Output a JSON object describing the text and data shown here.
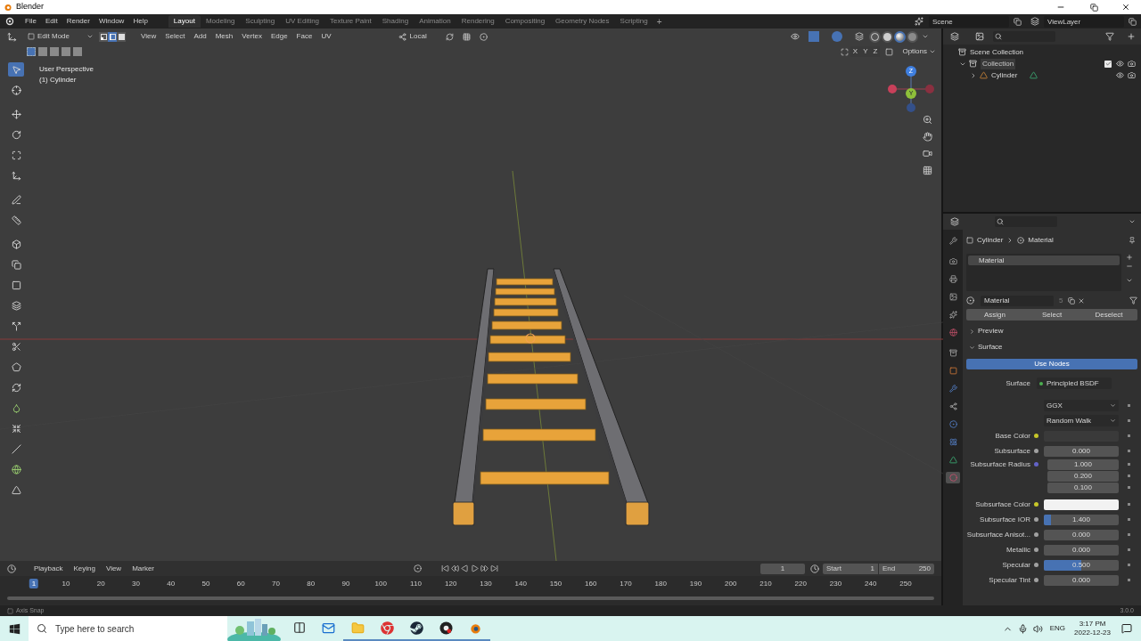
{
  "window": {
    "title": "Blender"
  },
  "menus": [
    "File",
    "Edit",
    "Render",
    "Window",
    "Help"
  ],
  "workspaces": [
    {
      "label": "Layout",
      "selected": true
    },
    {
      "label": "Modeling",
      "selected": false
    },
    {
      "label": "Sculpting",
      "selected": false
    },
    {
      "label": "UV Editing",
      "selected": false
    },
    {
      "label": "Texture Paint",
      "selected": false
    },
    {
      "label": "Shading",
      "selected": false
    },
    {
      "label": "Animation",
      "selected": false
    },
    {
      "label": "Rendering",
      "selected": false
    },
    {
      "label": "Compositing",
      "selected": false
    },
    {
      "label": "Geometry Nodes",
      "selected": false
    },
    {
      "label": "Scripting",
      "selected": false
    }
  ],
  "add_workspace": "+",
  "scene": "Scene",
  "view_layer": "ViewLayer",
  "viewport": {
    "mode": "Edit Mode",
    "select_modes": [
      {
        "kind": "vertex",
        "selected": false
      },
      {
        "kind": "edge",
        "selected": true
      },
      {
        "kind": "face",
        "selected": false
      }
    ],
    "menus": [
      "View",
      "Select",
      "Add",
      "Mesh",
      "Vertex",
      "Edge",
      "Face",
      "UV"
    ],
    "orientation": "Local",
    "shading": [
      {
        "kind": "wire",
        "selected": false
      },
      {
        "kind": "solid",
        "selected": false
      },
      {
        "kind": "material",
        "selected": true
      },
      {
        "kind": "rendered",
        "selected": false
      }
    ],
    "mirror_axes": [
      "X",
      "Y",
      "Z"
    ],
    "options": "Options",
    "overlay_text": [
      "User Perspective",
      "(1) Cylinder"
    ],
    "gizmo_labels": [
      "Z",
      "Y"
    ],
    "tools": [
      {
        "kind": "select",
        "selected": true
      },
      {
        "kind": "cursor",
        "selected": false
      },
      {
        "kind": "move",
        "selected": false
      },
      {
        "kind": "rotate",
        "selected": false
      },
      {
        "kind": "scale",
        "selected": false
      },
      {
        "kind": "transform",
        "selected": false
      },
      {
        "kind": "annotate",
        "selected": false
      },
      {
        "kind": "measure",
        "selected": false
      },
      {
        "kind": "add-cube",
        "selected": false
      },
      {
        "kind": "extrude",
        "selected": false
      },
      {
        "kind": "inset",
        "selected": false
      },
      {
        "kind": "bevel",
        "selected": false
      },
      {
        "kind": "loop-cut",
        "selected": false
      },
      {
        "kind": "knife",
        "selected": false
      },
      {
        "kind": "poly-build",
        "selected": false
      },
      {
        "kind": "spin",
        "selected": false
      },
      {
        "kind": "smooth",
        "selected": false
      },
      {
        "kind": "shrink",
        "selected": false
      },
      {
        "kind": "shear",
        "selected": false
      },
      {
        "kind": "to-sphere",
        "selected": false
      },
      {
        "kind": "rip",
        "selected": false
      }
    ]
  },
  "outliner": {
    "items": [
      {
        "label": "Scene Collection",
        "children": [
          {
            "label": "Collection",
            "expanded": true,
            "checked": true,
            "children": [
              {
                "label": "Cylinder",
                "expanded": false
              }
            ]
          }
        ]
      }
    ]
  },
  "properties": {
    "tabs": [
      {
        "kind": "tool",
        "selected": false
      },
      {
        "kind": "render",
        "selected": false
      },
      {
        "kind": "output",
        "selected": false
      },
      {
        "kind": "view-layer",
        "selected": false
      },
      {
        "kind": "scene",
        "selected": false
      },
      {
        "kind": "world",
        "selected": false
      },
      {
        "kind": "collection",
        "selected": false
      },
      {
        "kind": "object",
        "selected": false
      },
      {
        "kind": "modifier",
        "selected": false
      },
      {
        "kind": "particles",
        "selected": false
      },
      {
        "kind": "physics",
        "selected": false
      },
      {
        "kind": "constraints",
        "selected": false
      },
      {
        "kind": "data",
        "selected": false
      },
      {
        "kind": "material",
        "selected": true
      }
    ],
    "breadcrumb": [
      "Cylinder",
      "Material"
    ],
    "slots": [
      {
        "label": "Material",
        "selected": true
      }
    ],
    "material": {
      "name": "Material",
      "users": "5"
    },
    "buttons": [
      "Assign",
      "Select",
      "Deselect"
    ],
    "panels": [
      {
        "label": "Preview",
        "expanded": false
      },
      {
        "label": "Surface",
        "expanded": true
      }
    ],
    "use_nodes": "Use Nodes",
    "rows": [
      {
        "kind": "link",
        "label": "Surface",
        "value": "Principled BSDF",
        "color": "#4caf50"
      },
      {
        "kind": "dropdown",
        "value": "GGX"
      },
      {
        "kind": "dropdown",
        "value": "Random Walk"
      },
      {
        "kind": "swatch",
        "label": "Base Color",
        "color": "#c7c729",
        "swatch": {
          "color": "#3a3a3a"
        }
      },
      {
        "kind": "number",
        "label": "Subsurface",
        "value": "0.000",
        "color": "#a1a1a1"
      },
      {
        "kind": "vector",
        "label": "Subsurface Radius",
        "values": [
          "1.000",
          "0.200",
          "0.100"
        ],
        "color": "#6363c7"
      },
      {
        "kind": "swatch",
        "label": "Subsurface Color",
        "color": "#c7c729",
        "swatch": {
          "color": "#f2f2f2"
        }
      },
      {
        "kind": "number",
        "label": "Subsurface IOR",
        "value": "1.400",
        "level": 0.1,
        "color": "#a1a1a1"
      },
      {
        "kind": "number",
        "label": "Subsurface Anisot...",
        "value": "0.000",
        "color": "#a1a1a1"
      },
      {
        "kind": "number",
        "label": "Metallic",
        "value": "0.000",
        "color": "#a1a1a1"
      },
      {
        "kind": "number",
        "label": "Specular",
        "value": "0.500",
        "level": 0.5,
        "color": "#a1a1a1"
      },
      {
        "kind": "number",
        "label": "Specular Tint",
        "value": "0.000",
        "color": "#a1a1a1"
      }
    ]
  },
  "timeline": {
    "menus": [
      "Playback",
      "Keying",
      "View",
      "Marker"
    ],
    "frame": "1",
    "start_label": "Start",
    "start": "1",
    "end_label": "End",
    "end": "250",
    "ticks": [
      {
        "label": "1",
        "selected": true
      },
      {
        "label": "10",
        "selected": false
      },
      {
        "label": "20",
        "selected": false
      },
      {
        "label": "30",
        "selected": false
      },
      {
        "label": "40",
        "selected": false
      },
      {
        "label": "50",
        "selected": false
      },
      {
        "label": "60",
        "selected": false
      },
      {
        "label": "70",
        "selected": false
      },
      {
        "label": "80",
        "selected": false
      },
      {
        "label": "90",
        "selected": false
      },
      {
        "label": "100",
        "selected": false
      },
      {
        "label": "110",
        "selected": false
      },
      {
        "label": "120",
        "selected": false
      },
      {
        "label": "130",
        "selected": false
      },
      {
        "label": "140",
        "selected": false
      },
      {
        "label": "150",
        "selected": false
      },
      {
        "label": "160",
        "selected": false
      },
      {
        "label": "170",
        "selected": false
      },
      {
        "label": "180",
        "selected": false
      },
      {
        "label": "190",
        "selected": false
      },
      {
        "label": "200",
        "selected": false
      },
      {
        "label": "210",
        "selected": false
      },
      {
        "label": "220",
        "selected": false
      },
      {
        "label": "230",
        "selected": false
      },
      {
        "label": "240",
        "selected": false
      },
      {
        "label": "250",
        "selected": false
      }
    ]
  },
  "status_bar": {
    "hint": "Axis Snap",
    "version": "3.0.0"
  },
  "taskbar": {
    "search_placeholder": "Type here to search",
    "apps": [
      {
        "kind": "task-view",
        "running": false
      },
      {
        "kind": "mail",
        "running": false
      },
      {
        "kind": "folder",
        "running": true
      },
      {
        "kind": "chrome",
        "running": true
      },
      {
        "kind": "steam",
        "running": true
      },
      {
        "kind": "obs",
        "running": true
      },
      {
        "kind": "blender",
        "running": true
      }
    ],
    "language": "ENG",
    "time": "3:17 PM",
    "date": "2022-12-23"
  }
}
